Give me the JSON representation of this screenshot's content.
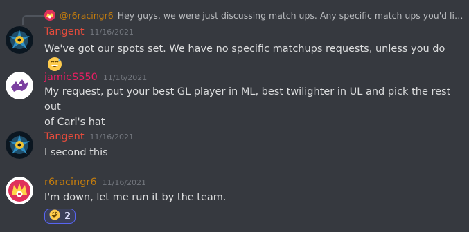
{
  "reply": {
    "username": "@r6racingr6",
    "preview": "Hey guys, we were just discussing match ups. Any specific match ups you'd like ..."
  },
  "messages": [
    {
      "username": "Tangent",
      "timestamp": "11/16/2021",
      "lines": [
        "We've got our spots set. We have no specific matchups requests, unless you do"
      ]
    },
    {
      "username": "jamieS550",
      "timestamp": "11/16/2021",
      "lines": [
        "My request, put your best GL player in ML, best twilighter in UL and pick the rest out",
        "of Carl's hat"
      ]
    },
    {
      "username": "Tangent",
      "timestamp": "11/16/2021",
      "lines": [
        "I second this"
      ]
    },
    {
      "username": "r6racingr6",
      "timestamp": "11/16/2021",
      "lines": [
        "I'm down, let me run it by the team."
      ]
    }
  ],
  "reaction": {
    "emoji": "rofl-emoji",
    "count": "2"
  },
  "colors": {
    "tangent": "#e74c3c",
    "jamie": "#e91e63",
    "r6": "#c27c0e",
    "background": "#36393f"
  }
}
